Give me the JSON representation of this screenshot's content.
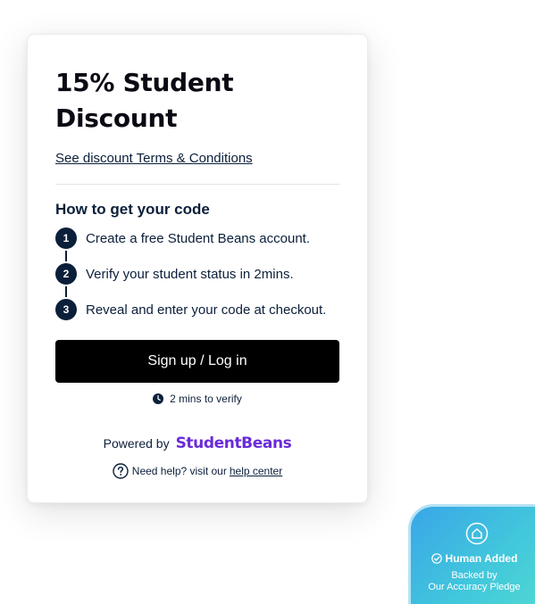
{
  "card": {
    "title": "15% Student Discount",
    "terms_link": "See discount Terms & Conditions",
    "steps_heading": "How to get your code",
    "steps": [
      {
        "number": "1",
        "text": "Create a free Student Beans account."
      },
      {
        "number": "2",
        "text": "Verify your student status in 2mins."
      },
      {
        "number": "3",
        "text": "Reveal and enter your code at checkout."
      }
    ],
    "signup_button": "Sign up / Log in",
    "verify_text": "2 mins to verify",
    "verify_icon": "clock-icon",
    "powered_by": "Powered by",
    "brand_name": "StudentBeans",
    "help_text": "Need help? visit our",
    "help_link": "help center",
    "help_icon": "question-circle-icon"
  },
  "badge": {
    "title": "Human Added",
    "line1": "Backed by",
    "line2": "Our Accuracy Pledge",
    "icon": "pledge-logo-icon",
    "check_icon": "check-circle-icon"
  },
  "colors": {
    "navy": "#0b1f3a",
    "brand_purple": "#6a2bd9",
    "button_bg": "#000000",
    "badge_gradient_start": "#3aa6e8",
    "badge_gradient_end": "#4dd6d4"
  }
}
